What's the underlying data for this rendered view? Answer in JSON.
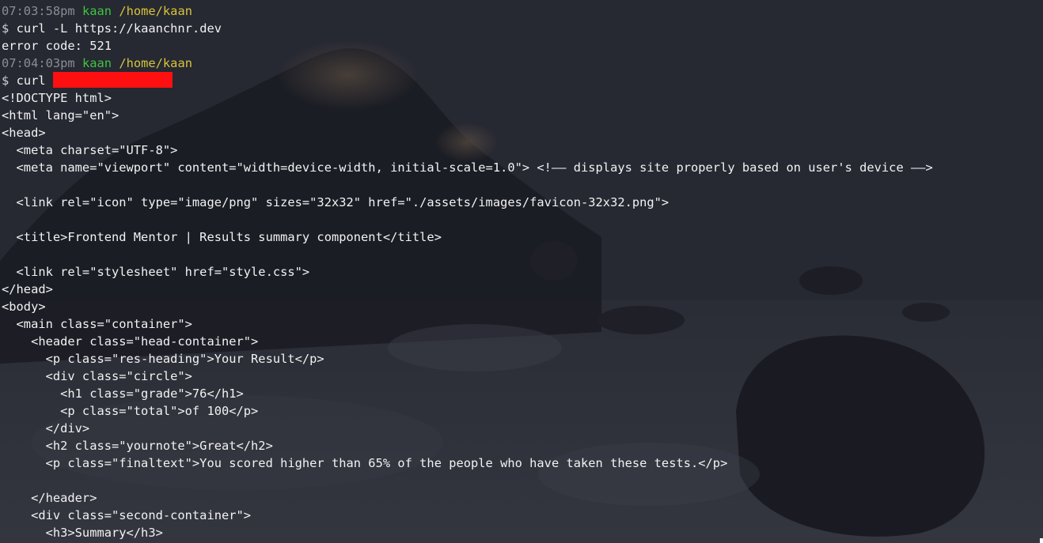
{
  "prompts": [
    {
      "time": "07:03:58pm",
      "user": "kaan",
      "path": "/home/kaan",
      "symbol": "$",
      "command": "curl -L https://kaanchnr.dev"
    },
    {
      "time": "07:04:03pm",
      "user": "kaan",
      "path": "/home/kaan",
      "symbol": "$",
      "command": "curl "
    }
  ],
  "error_output": "error code: 521",
  "html_output": [
    "<!DOCTYPE html>",
    "<html lang=\"en\">",
    "<head>",
    "  <meta charset=\"UTF-8\">",
    "  <meta name=\"viewport\" content=\"width=device-width, initial-scale=1.0\"> <!—— displays site properly based on user's device ——>",
    "",
    "  <link rel=\"icon\" type=\"image/png\" sizes=\"32x32\" href=\"./assets/images/favicon-32x32.png\">",
    "",
    "  <title>Frontend Mentor | Results summary component</title>",
    "",
    "  <link rel=\"stylesheet\" href=\"style.css\">",
    "</head>",
    "<body>",
    "  <main class=\"container\">",
    "    <header class=\"head-container\">",
    "      <p class=\"res-heading\">Your Result</p>",
    "      <div class=\"circle\">",
    "        <h1 class=\"grade\">76</h1>",
    "        <p class=\"total\">of 100</p>",
    "      </div>",
    "      <h2 class=\"yournote\">Great</h2>",
    "      <p class=\"finaltext\">You scored higher than 65% of the people who have taken these tests.</p>",
    "",
    "    </header>",
    "    <div class=\"second-container\">",
    "      <h3>Summary</h3>"
  ],
  "colors": {
    "background": "#242630",
    "text": "#f2f2f2",
    "time": "#8a8c96",
    "user": "#3fc53f",
    "path": "#d8c43a",
    "redaction": "#ff1010"
  }
}
